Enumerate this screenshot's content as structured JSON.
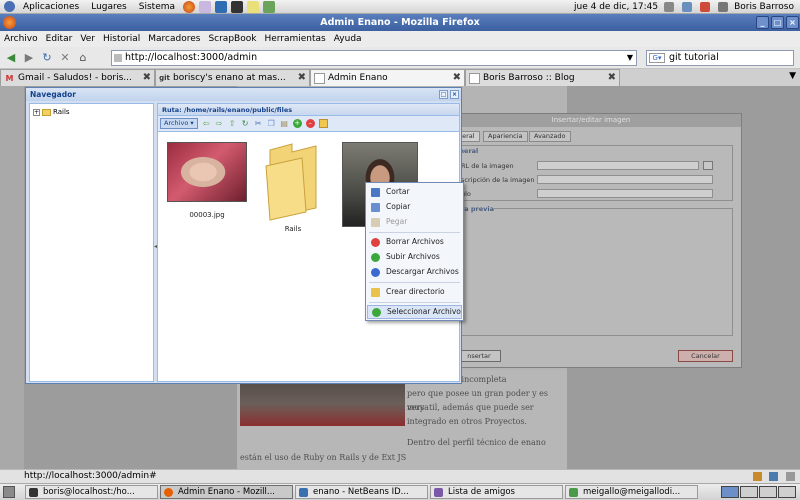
{
  "top_panel": {
    "menus": [
      "Aplicaciones",
      "Lugares",
      "Sistema"
    ],
    "clock": "jue  4 de dic, 17:45",
    "user": "Boris Barroso"
  },
  "window": {
    "title": "Admin Enano - Mozilla Firefox"
  },
  "menubar": {
    "items": [
      "Archivo",
      "Editar",
      "Ver",
      "Historial",
      "Marcadores",
      "ScrapBook",
      "Herramientas",
      "Ayuda"
    ]
  },
  "navbar": {
    "url": "http://localhost:3000/admin",
    "search_value": "git tutorial"
  },
  "tabs": [
    {
      "label": "Gmail - Saludos! - boris...",
      "favicon": "gmail-icon"
    },
    {
      "label": "boriscy's enano at mas...",
      "favicon": "github-icon"
    },
    {
      "label": "Admin Enano",
      "favicon": "page-icon",
      "active": true
    },
    {
      "label": "Boris Barroso :: Blog",
      "favicon": "page-icon"
    }
  ],
  "page": {
    "article_lines": [
      "que aún esta incompleta",
      "pero que posee un gran poder y es muy",
      "versatil, además que puede ser",
      "integrado en otros Proyectos.",
      "Dentro del perfil técnico de enano",
      "están el uso de Ruby on Rails y de Ext JS"
    ]
  },
  "image_dialog": {
    "title": "Insertar/editar imagen",
    "tabs": [
      "neral",
      "Apariencia",
      "Avanzado"
    ],
    "section_general": "eneral",
    "fields": [
      "RL de la imagen",
      "scripción de la imagen",
      "ulo"
    ],
    "section_preview": "ista previa",
    "insert_label": "nsertar",
    "cancel_label": "Cancelar"
  },
  "navigator": {
    "title": "Navegador",
    "tree_root": "Rails",
    "path": "Ruta: /home/rails/enano/public/files",
    "archivo_label": "Archivo",
    "files": [
      {
        "name": "00003.jpg",
        "kind": "image-baby"
      },
      {
        "name": "Rails",
        "kind": "folder"
      },
      {
        "name": "",
        "kind": "image-man"
      }
    ]
  },
  "context_menu": {
    "items": [
      {
        "label": "Cortar",
        "icon": "scissors-icon",
        "color": "#4a78c2"
      },
      {
        "label": "Copiar",
        "icon": "copy-icon",
        "color": "#6a8fd0"
      },
      {
        "label": "Pegar",
        "icon": "paste-icon",
        "color": "#c8b48a",
        "disabled": true
      },
      {
        "label": "Borrar Archivos",
        "icon": "delete-icon",
        "color": "#e04040"
      },
      {
        "label": "Subir Archivos",
        "icon": "upload-icon",
        "color": "#3aa83a"
      },
      {
        "label": "Descargar Archivos",
        "icon": "download-icon",
        "color": "#3a6ad0"
      },
      {
        "label": "Crear directorio",
        "icon": "folder-icon",
        "color": "#e8c24a"
      },
      {
        "label": "Seleccionar Archivo",
        "icon": "select-icon",
        "color": "#3aa83a",
        "highlighted": true
      }
    ]
  },
  "statusbar": {
    "text": "http://localhost:3000/admin#"
  },
  "taskbar": {
    "tasks": [
      {
        "label": "boris@localhost:/ho...",
        "color": "#333333"
      },
      {
        "label": "Admin Enano - Mozill...",
        "color": "#e66000",
        "active": true
      },
      {
        "label": "enano - NetBeans ID...",
        "color": "#3a6fb0"
      },
      {
        "label": "Lista de amigos",
        "color": "#7a5aa8"
      },
      {
        "label": "meigallo@meigallodi...",
        "color": "#4a9a4a"
      }
    ]
  }
}
